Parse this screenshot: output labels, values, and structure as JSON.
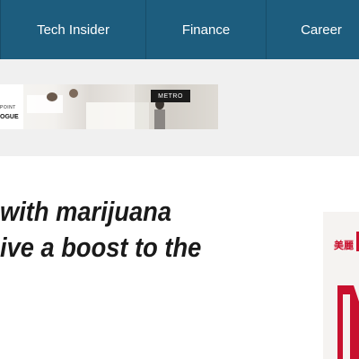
{
  "nav": {
    "items": [
      {
        "label": "Tech Insider"
      },
      {
        "label": "Finance"
      },
      {
        "label": "Career"
      }
    ],
    "background": "#1d5d7e",
    "text_color": "#ffffff"
  },
  "ad": {
    "brand_small": "POINT",
    "brand_large": "OGUE",
    "badge": "METRO",
    "icon": "ad-banner-image"
  },
  "article": {
    "headline_line1": "with marijuana",
    "headline_line2": "ive a boost to the"
  },
  "side": {
    "logo_text": "美麗",
    "accent": "#c8102e"
  }
}
